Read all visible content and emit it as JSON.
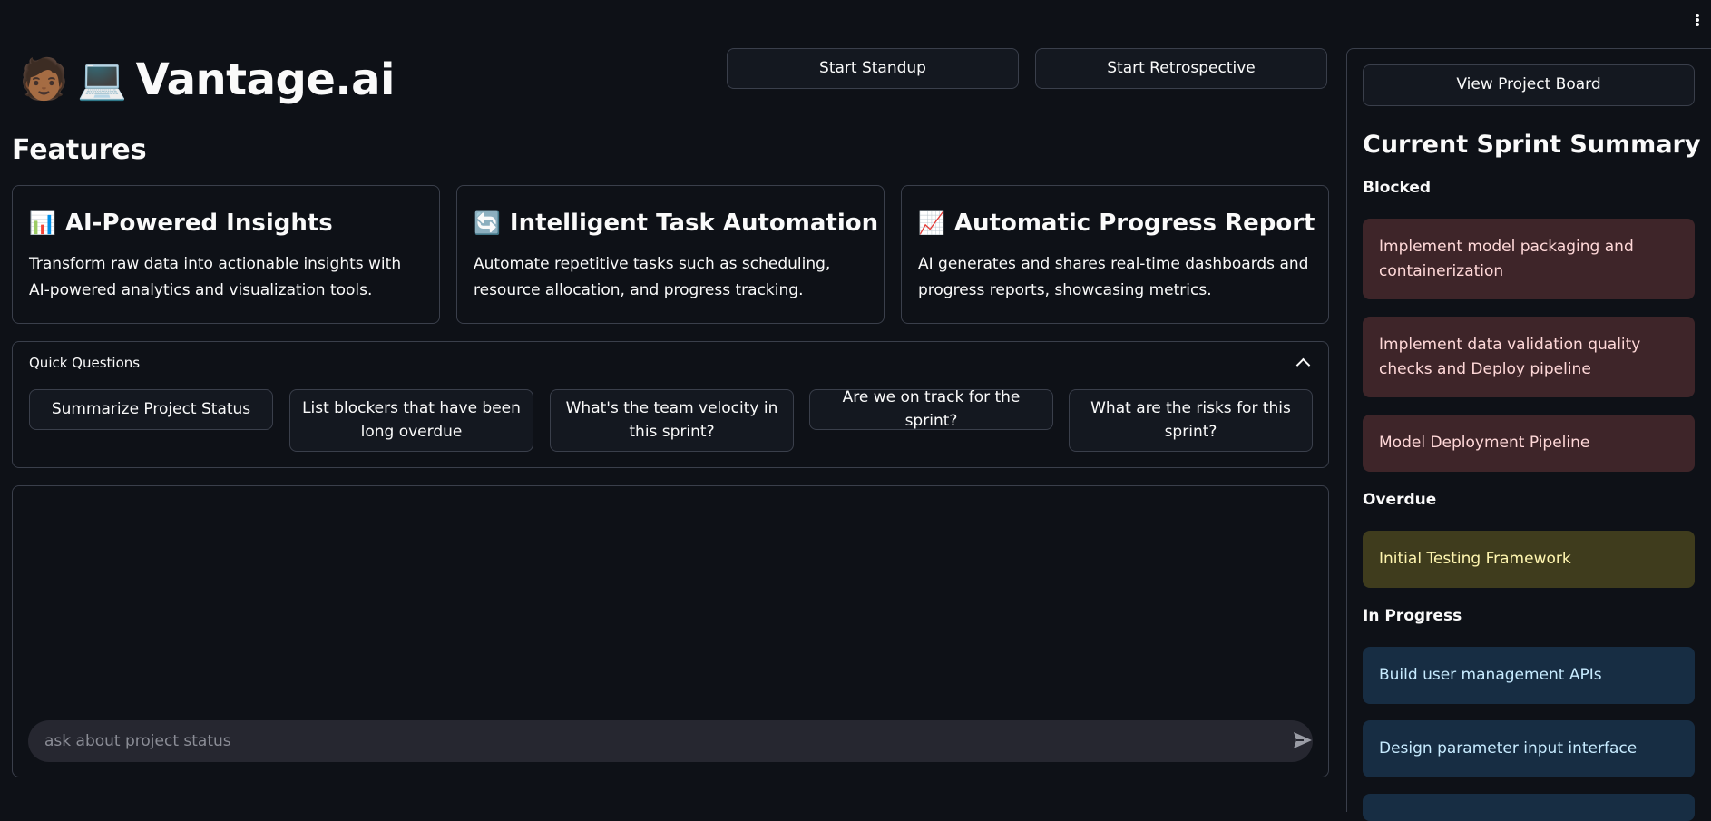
{
  "app": {
    "avatar_icon": "person-emoji-icon",
    "laptop_icon": "laptop-emoji-icon",
    "title": "Vantage.ai"
  },
  "header": {
    "standup_label": "Start Standup",
    "retro_label": "Start Retrospective"
  },
  "features": {
    "title": "Features",
    "cards": [
      {
        "icon": "bar-chart-icon",
        "title": "AI-Powered Insights",
        "desc": "Transform raw data into actionable insights with AI-powered analytics and visualization tools."
      },
      {
        "icon": "refresh-arrows-icon",
        "title": "Intelligent Task Automation",
        "desc": "Automate repetitive tasks such as scheduling, resource allocation, and progress tracking."
      },
      {
        "icon": "trending-up-icon",
        "title": "Automatic Progress Report",
        "desc": "AI generates and shares real-time dashboards and progress reports, showcasing metrics."
      }
    ]
  },
  "quick": {
    "label": "Quick Questions",
    "buttons": [
      "Summarize Project Status",
      "List blockers that have been long overdue",
      "What's the team velocity in this sprint?",
      "Are we on track for the sprint?",
      "What are the risks for this sprint?"
    ]
  },
  "chat": {
    "placeholder": "ask about project status"
  },
  "sidebar": {
    "board_label": "View Project Board",
    "title": "Current Sprint Summary",
    "blocked_label": "Blocked",
    "blocked": [
      "Implement model packaging and containerization",
      "Implement data validation quality checks and Deploy pipeline",
      "Model Deployment Pipeline"
    ],
    "overdue_label": "Overdue",
    "overdue": [
      "Initial Testing Framework"
    ],
    "progress_label": "In Progress",
    "progress": [
      "Build user management APIs",
      "Design parameter input interface"
    ]
  },
  "colors": {
    "background": "#0e1117",
    "border": "#3a3f4b",
    "blocked": "#3e2529",
    "overdue": "#3f3c1d",
    "in_progress": "#172d43"
  }
}
